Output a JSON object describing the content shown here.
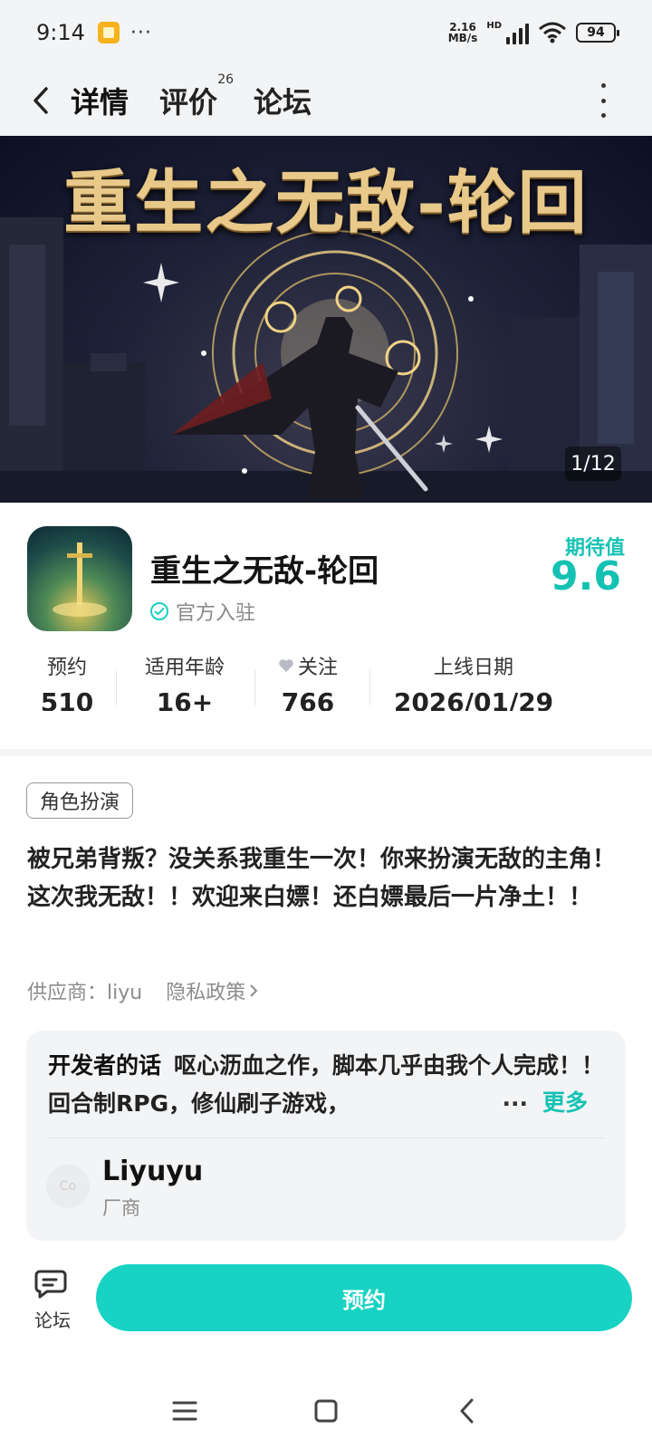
{
  "status_bar": {
    "time": "9:14",
    "dots": "···",
    "net_speed_value": "2.16",
    "net_speed_unit": "MB/s",
    "hd_label": "HD",
    "battery": "94"
  },
  "nav": {
    "tabs": [
      {
        "label": "详情",
        "active": true
      },
      {
        "label": "评价",
        "count": "26"
      },
      {
        "label": "论坛"
      }
    ]
  },
  "banner": {
    "title": "重生之无敌-轮回",
    "counter": "1/12"
  },
  "app": {
    "name": "重生之无敌-轮回",
    "verified_label": "官方入驻",
    "rating_label": "期待值",
    "rating_value": "9.6",
    "accent_color": "#19cfc0"
  },
  "stats": [
    {
      "label": "预约",
      "value": "510"
    },
    {
      "label": "适用年龄",
      "value": "16+"
    },
    {
      "label": "关注",
      "value": "766"
    },
    {
      "label": "上线日期",
      "value": "2026/01/29"
    }
  ],
  "tag": "角色扮演",
  "description": "被兄弟背叛？没关系我重生一次！你来扮演无敌的主角！这次我无敌！！欢迎来白嫖！还白嫖最后一片净土！！",
  "meta": {
    "supplier": "供应商：liyu",
    "privacy": "隐私政策"
  },
  "developer": {
    "label": "开发者的话",
    "text": "呕心沥血之作，脚本几乎由我个人完成！！回合制RPG，修仙刷子游戏，",
    "ellipsis": "...",
    "more": "更多",
    "avatar_text": "Co",
    "name": "Liyuyu",
    "role": "厂商"
  },
  "bottom": {
    "forum_label": "论坛",
    "reserve_label": "预约"
  }
}
